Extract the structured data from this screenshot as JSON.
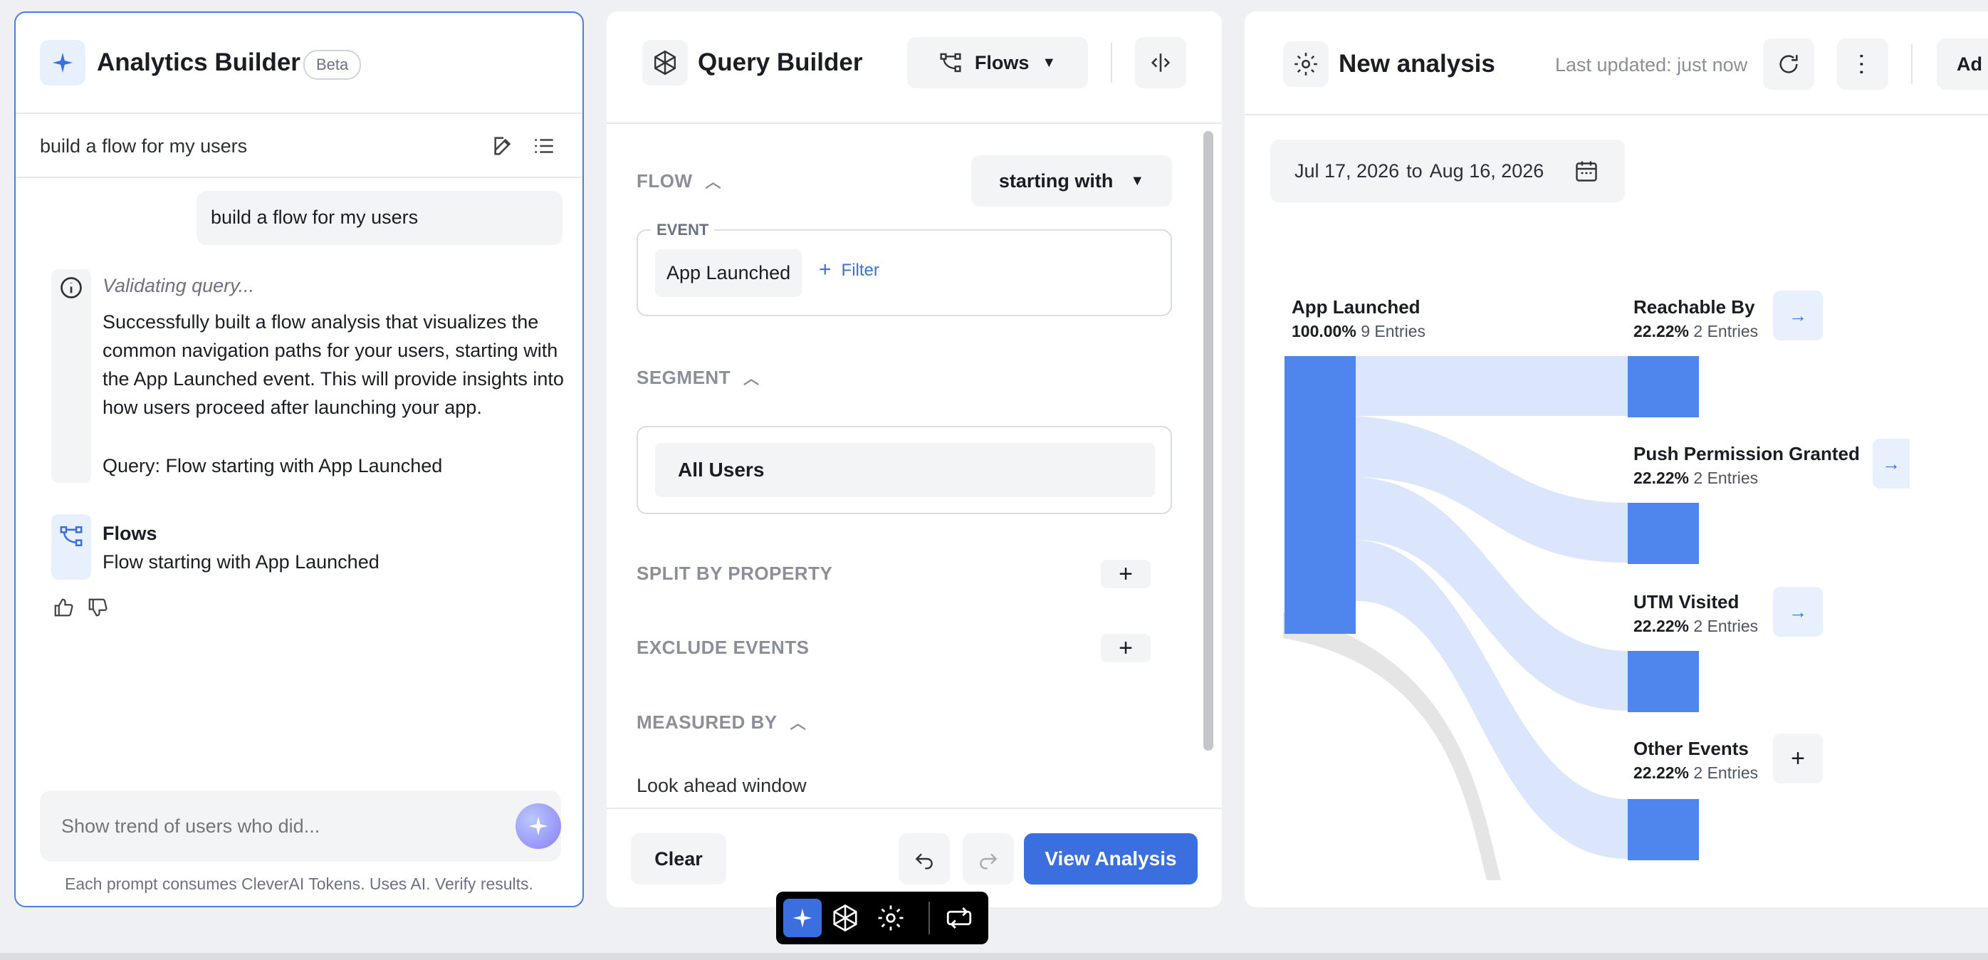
{
  "assistant": {
    "title": "Analytics Builder",
    "badge": "Beta",
    "conversation_title": "build a flow for my users",
    "user_message": "build a flow for my users",
    "status": "Validating query...",
    "response": "Successfully built a flow analysis that visualizes the common navigation paths for your users, starting with the App Launched event. This will provide insights into how users proceed after launching your app.",
    "query_line": "Query: Flow starting with App Launched",
    "card_title": "Flows",
    "card_subtitle": "Flow starting with App Launched",
    "input_placeholder": "Show trend of users who did...",
    "disclaimer": "Each prompt consumes CleverAI Tokens. Uses AI. Verify results."
  },
  "query": {
    "title": "Query Builder",
    "type_label": "Flows",
    "flow_label": "FLOW",
    "mode_label": "starting with",
    "event_label": "EVENT",
    "event_value": "App Launched",
    "filter_label": "Filter",
    "segment_label": "SEGMENT",
    "segment_value": "All Users",
    "split_label": "SPLIT BY PROPERTY",
    "exclude_label": "EXCLUDE EVENTS",
    "measured_label": "MEASURED BY",
    "lookahead_label": "Look ahead window",
    "clear_label": "Clear",
    "view_label": "View Analysis"
  },
  "analysis": {
    "title": "New analysis",
    "updated": "Last updated: just now",
    "add_label": "Ad",
    "date_start": "Jul 17, 2026",
    "date_sep": "to",
    "date_end": "Aug 16, 2026",
    "source": {
      "name": "App Launched",
      "pct": "100.00%",
      "entries": "9 Entries"
    },
    "targets": [
      {
        "name": "Reachable By",
        "pct": "22.22%",
        "entries": "2 Entries"
      },
      {
        "name": "Push Permission Granted",
        "pct": "22.22%",
        "entries": "2 Entries"
      },
      {
        "name": "UTM Visited",
        "pct": "22.22%",
        "entries": "2 Entries"
      },
      {
        "name": "Other Events",
        "pct": "22.22%",
        "entries": "2 Entries"
      }
    ]
  },
  "colors": {
    "accent": "#3b6fe0",
    "node": "#4f86ee",
    "link": "#dbe6fd",
    "dropoff": "#e5e5e5"
  }
}
